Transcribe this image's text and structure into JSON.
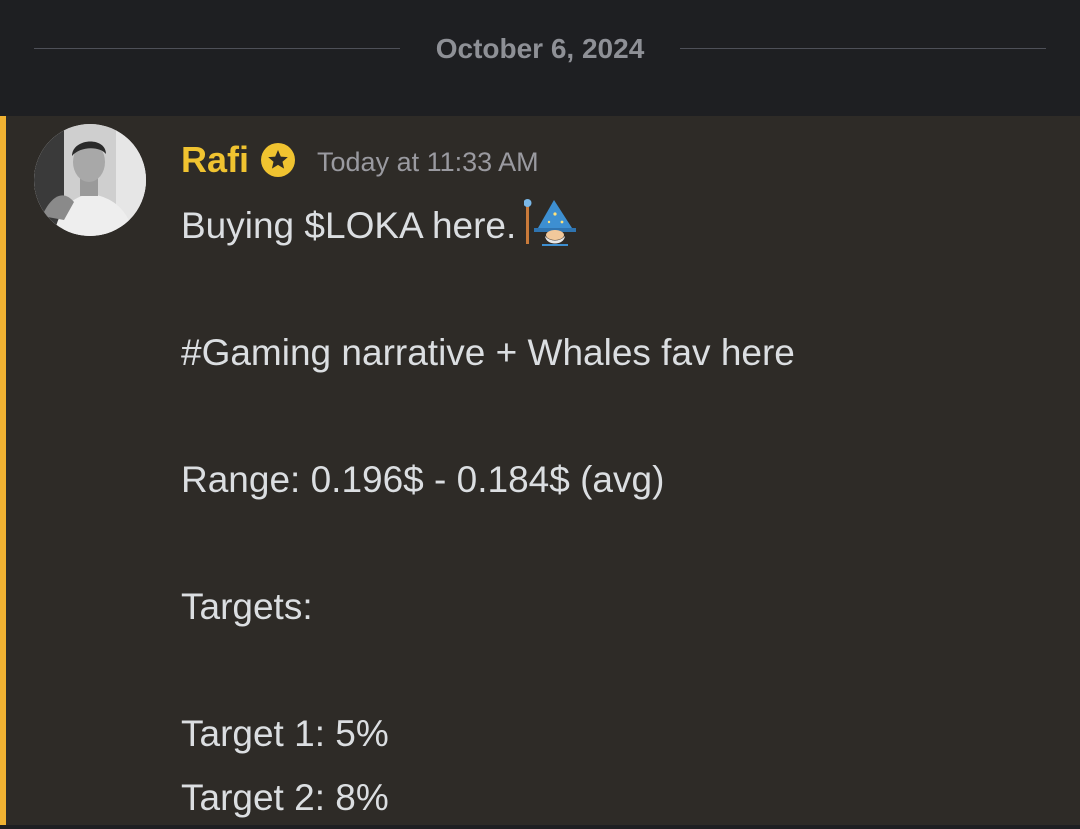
{
  "date_divider": {
    "label": "October 6, 2024"
  },
  "message": {
    "author": "Rafi",
    "author_color": "#f0c330",
    "badge_icon": "star-badge-icon",
    "timestamp": "Today at 11:33 AM",
    "highlight_color": "#f0b232",
    "emoji": "mage-emoji",
    "lines": {
      "l0": "Buying $LOKA here.",
      "l1": "#Gaming narrative + Whales fav here",
      "l2": "Range: 0.196$ - 0.184$ (avg)",
      "l3": "Targets:",
      "l4": "Target 1: 5%",
      "l5": "Target 2: 8%"
    }
  }
}
